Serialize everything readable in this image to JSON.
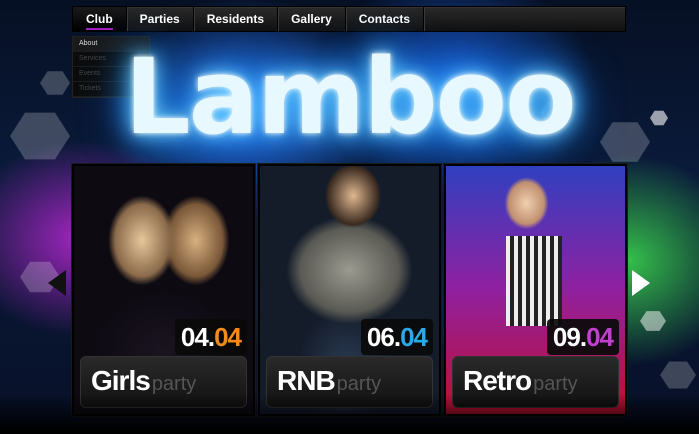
{
  "nav": {
    "items": [
      {
        "label": "Club",
        "active": true
      },
      {
        "label": "Parties",
        "active": false
      },
      {
        "label": "Residents",
        "active": false
      },
      {
        "label": "Gallery",
        "active": false
      },
      {
        "label": "Contacts",
        "active": false
      }
    ],
    "submenu": [
      "About",
      "Services",
      "Events",
      "Tickets"
    ]
  },
  "logo": "Lamboo",
  "cards": [
    {
      "date_day": "04.",
      "date_month": "04",
      "month_color": "#f28a1c",
      "title": "Girls",
      "suffix": "party"
    },
    {
      "date_day": "06.",
      "date_month": "04",
      "month_color": "#2aa8e8",
      "title": "RNB",
      "suffix": "party"
    },
    {
      "date_day": "09.",
      "date_month": "04",
      "month_color": "#c040d0",
      "title": "Retro",
      "suffix": "party"
    }
  ],
  "icons": {
    "prev": "chevron-left-icon",
    "next": "chevron-right-icon"
  }
}
